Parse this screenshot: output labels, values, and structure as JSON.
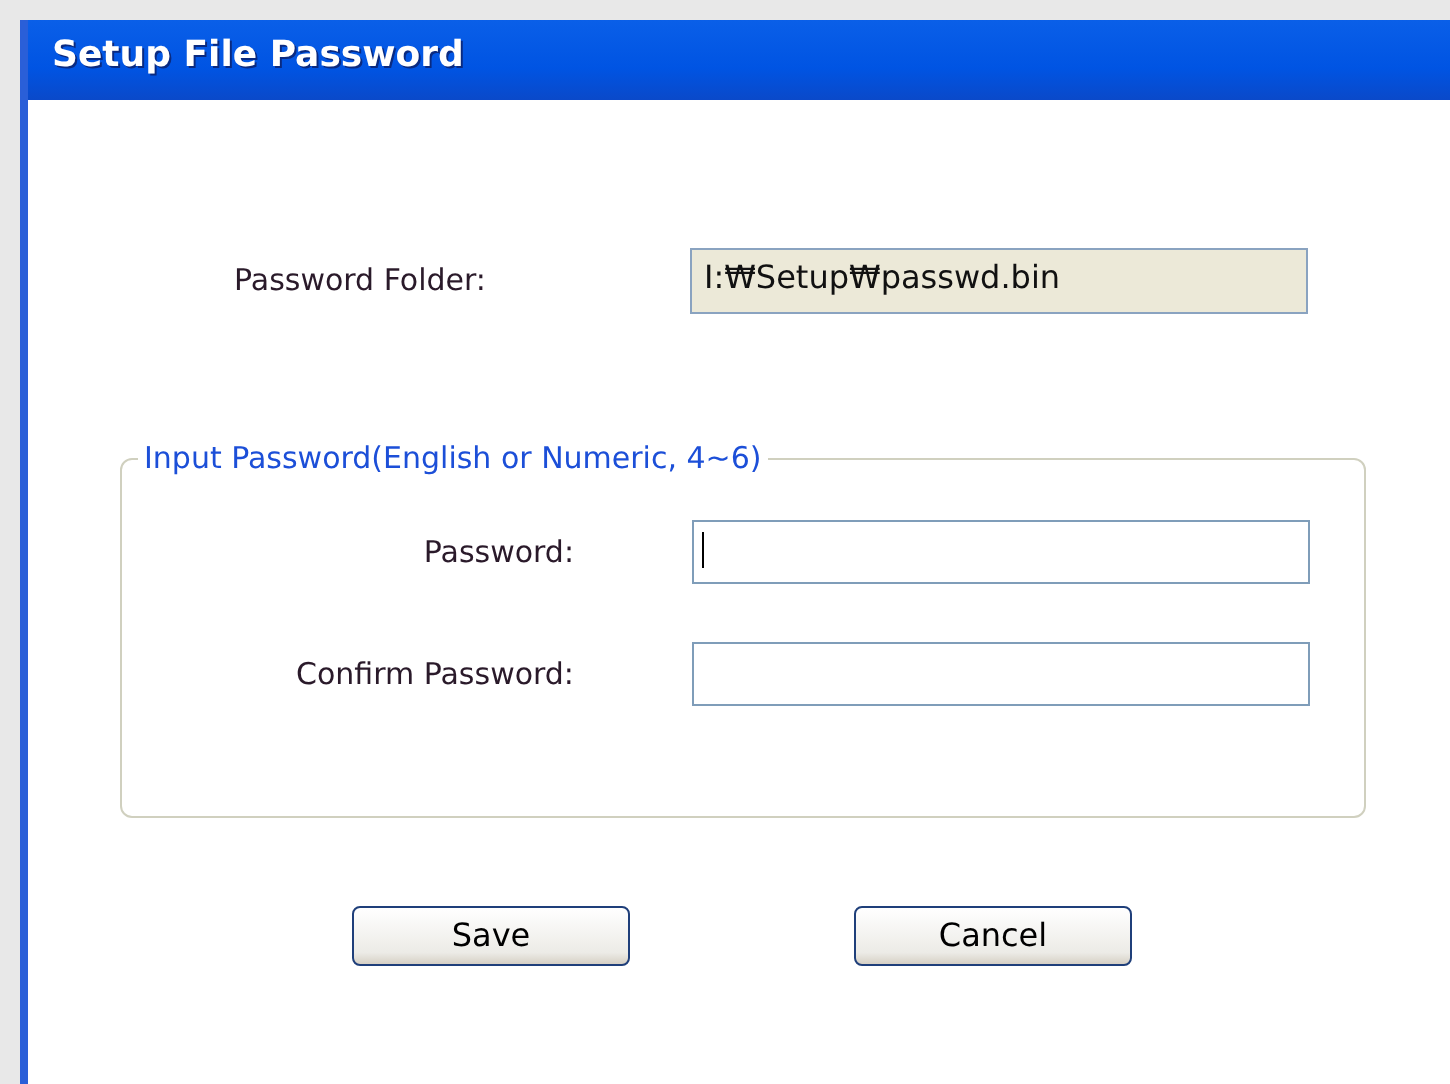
{
  "window": {
    "title": "Setup File Password"
  },
  "folder": {
    "label": "Password Folder:",
    "value": "I:₩Setup₩passwd.bin"
  },
  "group": {
    "legend": "Input Password(English or Numeric, 4~6)",
    "fields": [
      {
        "label": "Password:",
        "focused": true
      },
      {
        "label": "Confirm Password:",
        "focused": false
      }
    ]
  },
  "buttons": [
    "Save",
    "Cancel"
  ]
}
